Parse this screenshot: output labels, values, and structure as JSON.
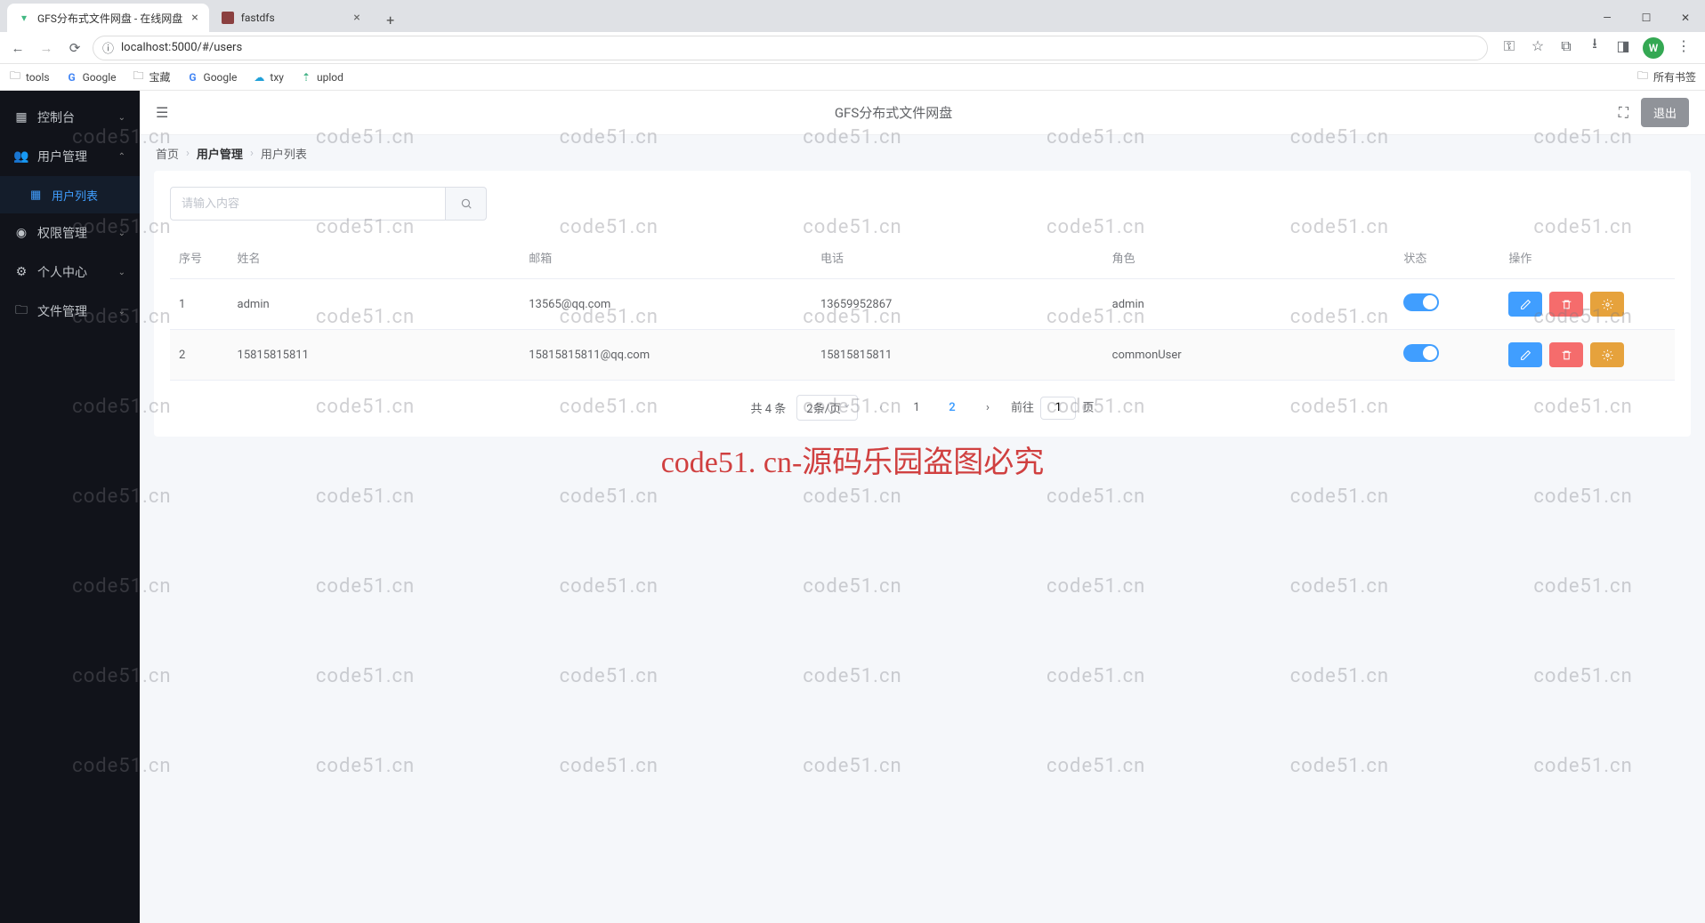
{
  "browser": {
    "tabs": [
      {
        "title": "GFS分布式文件网盘 - 在线网盘",
        "favicon_color": "#42b883"
      },
      {
        "title": "fastdfs",
        "favicon_color": "#8b4040"
      }
    ],
    "url": "localhost:5000/#/users",
    "avatar_letter": "W",
    "bookmarks": [
      {
        "label": "tools",
        "icon": "folder"
      },
      {
        "label": "Google",
        "icon": "g"
      },
      {
        "label": "宝藏",
        "icon": "folder"
      },
      {
        "label": "Google",
        "icon": "g"
      },
      {
        "label": "txy",
        "icon": "cloud"
      },
      {
        "label": "uplod",
        "icon": "up"
      }
    ],
    "all_bookmarks_label": "所有书签"
  },
  "sidebar": {
    "items": [
      {
        "icon": "dashboard",
        "label": "控制台",
        "expanded": false
      },
      {
        "icon": "users",
        "label": "用户管理",
        "expanded": true,
        "children": [
          {
            "icon": "grid",
            "label": "用户列表",
            "active": true
          }
        ]
      },
      {
        "icon": "lock",
        "label": "权限管理",
        "expanded": false
      },
      {
        "icon": "gear",
        "label": "个人中心",
        "expanded": false
      },
      {
        "icon": "folder",
        "label": "文件管理",
        "expanded": false
      }
    ]
  },
  "topbar": {
    "title": "GFS分布式文件网盘",
    "logout_label": "退出"
  },
  "breadcrumb": {
    "items": [
      "首页",
      "用户管理",
      "用户列表"
    ]
  },
  "search": {
    "placeholder": "请输入内容"
  },
  "table": {
    "headers": [
      "序号",
      "姓名",
      "邮箱",
      "电话",
      "角色",
      "状态",
      "操作"
    ],
    "rows": [
      {
        "index": "1",
        "name": "admin",
        "email": "13565@qq.com",
        "phone": "13659952867",
        "role": "admin",
        "status_on": true
      },
      {
        "index": "2",
        "name": "15815815811",
        "email": "15815815811@qq.com",
        "phone": "15815815811",
        "role": "commonUser",
        "status_on": true
      }
    ]
  },
  "pagination": {
    "total_label": "共 4 条",
    "per_page_label": "2条/页",
    "pages": [
      "1",
      "2"
    ],
    "current_page": "2",
    "jump_prefix": "前往",
    "jump_value": "1",
    "jump_suffix": "页"
  },
  "watermark": {
    "text": "code51.cn",
    "big_text": "code51. cn-源码乐园盗图必究"
  }
}
